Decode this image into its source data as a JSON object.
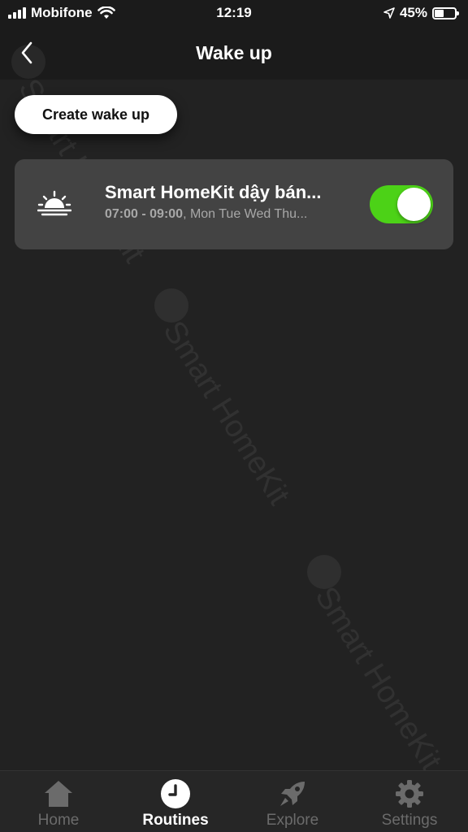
{
  "status_bar": {
    "carrier": "Mobifone",
    "time": "12:19",
    "battery_percent": "45%",
    "battery_level": 0.45
  },
  "nav": {
    "title": "Wake up",
    "back_icon": "chevron-left-icon"
  },
  "create_button": {
    "label": "Create wake up"
  },
  "routines": [
    {
      "icon": "sunrise-icon",
      "name": "Smart HomeKit dậy bán...",
      "time_range": "07:00 - 09:00",
      "days": ", Mon Tue Wed Thu...",
      "enabled": true
    }
  ],
  "watermark": {
    "text": "Smart HomeKit"
  },
  "tab_bar": {
    "tabs": [
      {
        "label": "Home",
        "icon": "home-icon",
        "active": false
      },
      {
        "label": "Routines",
        "icon": "clock-icon",
        "active": true
      },
      {
        "label": "Explore",
        "icon": "rocket-icon",
        "active": false
      },
      {
        "label": "Settings",
        "icon": "gear-icon",
        "active": false
      }
    ]
  },
  "colors": {
    "background": "#222222",
    "card": "#434343",
    "toggle_on": "#4cd217"
  }
}
